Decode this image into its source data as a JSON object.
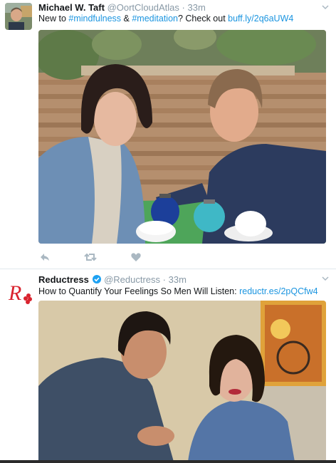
{
  "tweets": [
    {
      "author": {
        "name": "Michael W. Taft",
        "handle": "@OortCloudAtlas",
        "verified": false
      },
      "separator": "·",
      "time": "33m",
      "text_parts": {
        "before": "New to ",
        "hashtag1": "#mindfulness",
        "middle": " & ",
        "hashtag2": "#meditation",
        "after": "? Check out ",
        "link": "buff.ly/2q6aUW4"
      },
      "photo": {
        "subject": "man and woman sitting at a green table with blue teapots and white cups"
      },
      "actions": [
        "reply-icon",
        "retweet-icon",
        "like-icon"
      ]
    },
    {
      "author": {
        "name": "Reductress",
        "handle": "@Reductress",
        "verified": true,
        "logo_text": "R"
      },
      "separator": "·",
      "time": "33m",
      "text_parts": {
        "before": "How to Quantify Your Feelings So Men Will Listen: ",
        "link": "reductr.es/2pQCfw4"
      },
      "photo": {
        "subject": "smiling man and woman in denim shirts"
      }
    }
  ],
  "colors": {
    "link": "#1b95e0",
    "meta": "#8899a6",
    "text": "#14171a",
    "action_icon": "#aab8c2",
    "verified": "#1da1f2",
    "reductress_red": "#d9232e"
  }
}
